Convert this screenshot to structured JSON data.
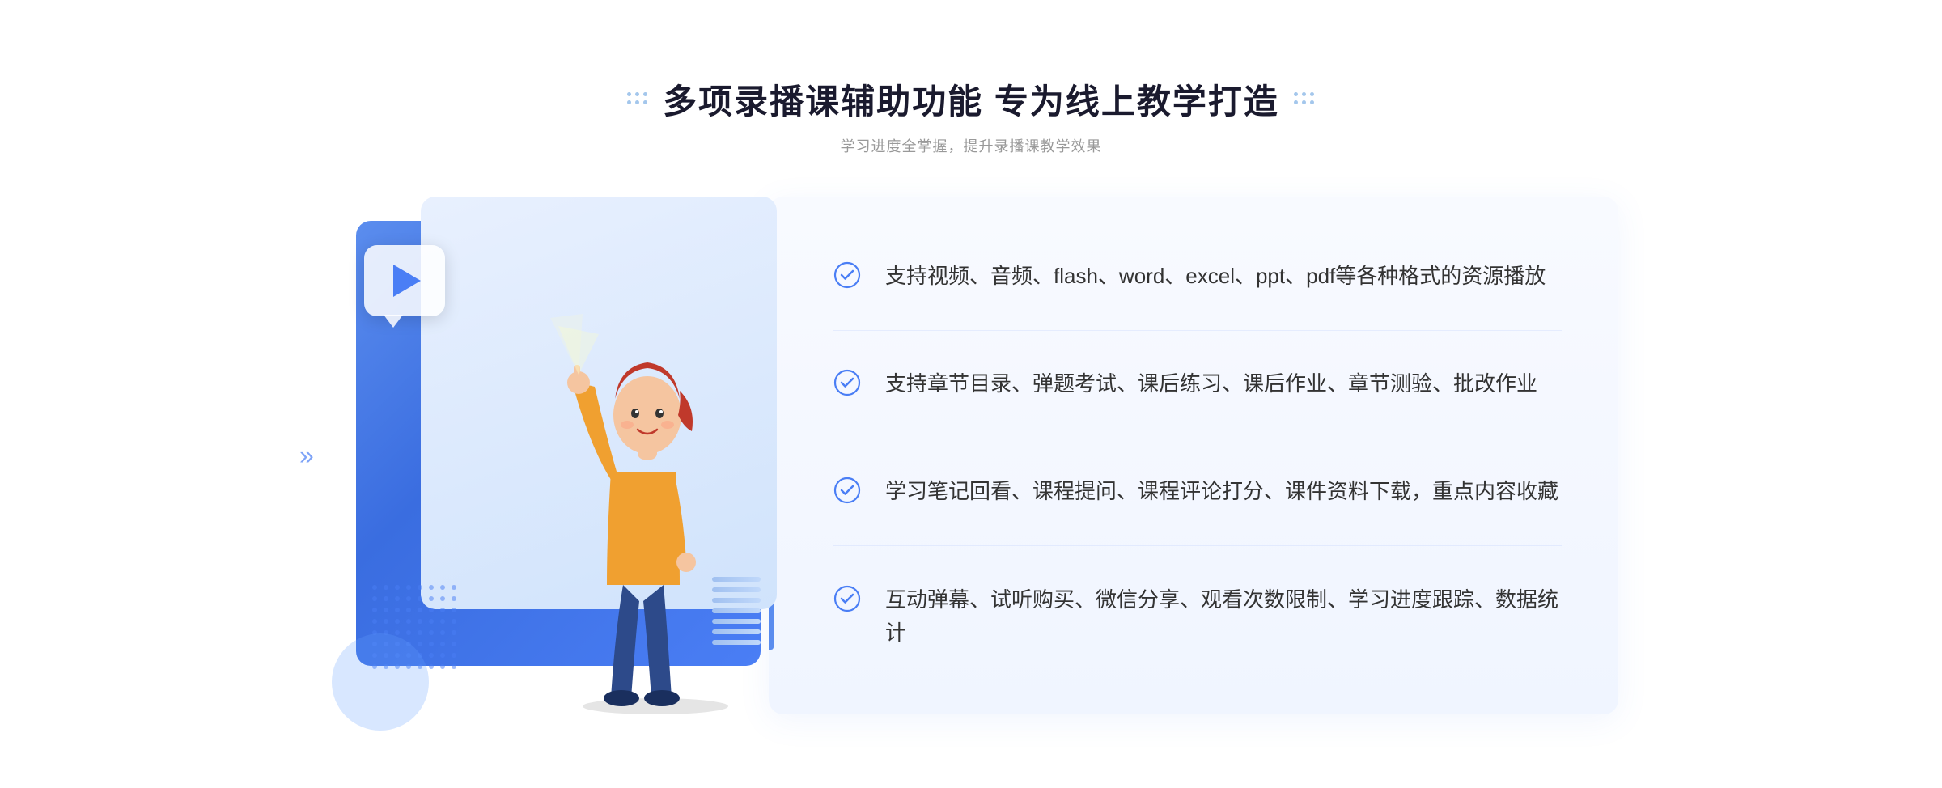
{
  "page": {
    "background": "#ffffff"
  },
  "header": {
    "title": "多项录播课辅助功能 专为线上教学打造",
    "subtitle": "学习进度全掌握，提升录播课教学效果",
    "dots_left": true,
    "dots_right": true
  },
  "features": [
    {
      "id": 1,
      "text": "支持视频、音频、flash、word、excel、ppt、pdf等各种格式的资源播放"
    },
    {
      "id": 2,
      "text": "支持章节目录、弹题考试、课后练习、课后作业、章节测验、批改作业"
    },
    {
      "id": 3,
      "text": "学习笔记回看、课程提问、课程评论打分、课件资料下载，重点内容收藏"
    },
    {
      "id": 4,
      "text": "互动弹幕、试听购买、微信分享、观看次数限制、学习进度跟踪、数据统计"
    }
  ],
  "colors": {
    "primary": "#4a7ef5",
    "primary_light": "#5b8dee",
    "text_dark": "#1a1a2e",
    "text_gray": "#999999",
    "text_body": "#333333",
    "bg_panel": "#f8faff"
  },
  "decorations": {
    "arrows_left": "»",
    "play_button": "▶"
  }
}
